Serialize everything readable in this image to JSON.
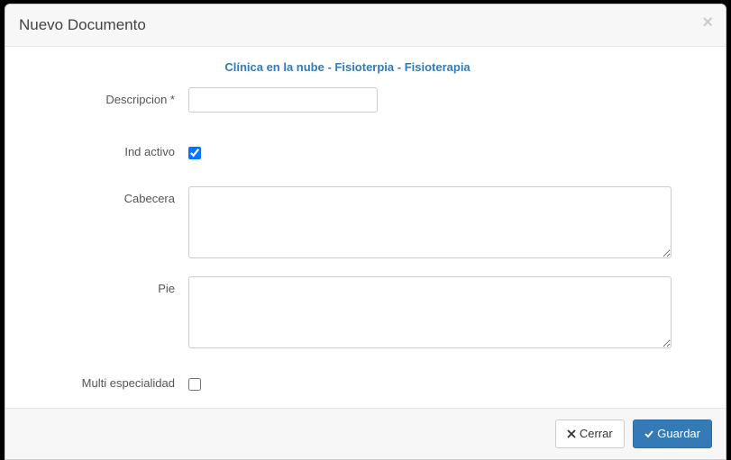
{
  "modal": {
    "title": "Nuevo Documento"
  },
  "breadcrumb": "Clínica en la nube - Fisioterpia - Fisioterapia",
  "form": {
    "descripcion": {
      "label": "Descripcion *",
      "value": ""
    },
    "ind_activo": {
      "label": "Ind activo",
      "checked": true
    },
    "cabecera": {
      "label": "Cabecera",
      "value": ""
    },
    "pie": {
      "label": "Pie",
      "value": ""
    },
    "multi_especialidad": {
      "label": "Multi especialidad",
      "checked": false
    }
  },
  "footer": {
    "cerrar": "Cerrar",
    "guardar": "Guardar"
  }
}
